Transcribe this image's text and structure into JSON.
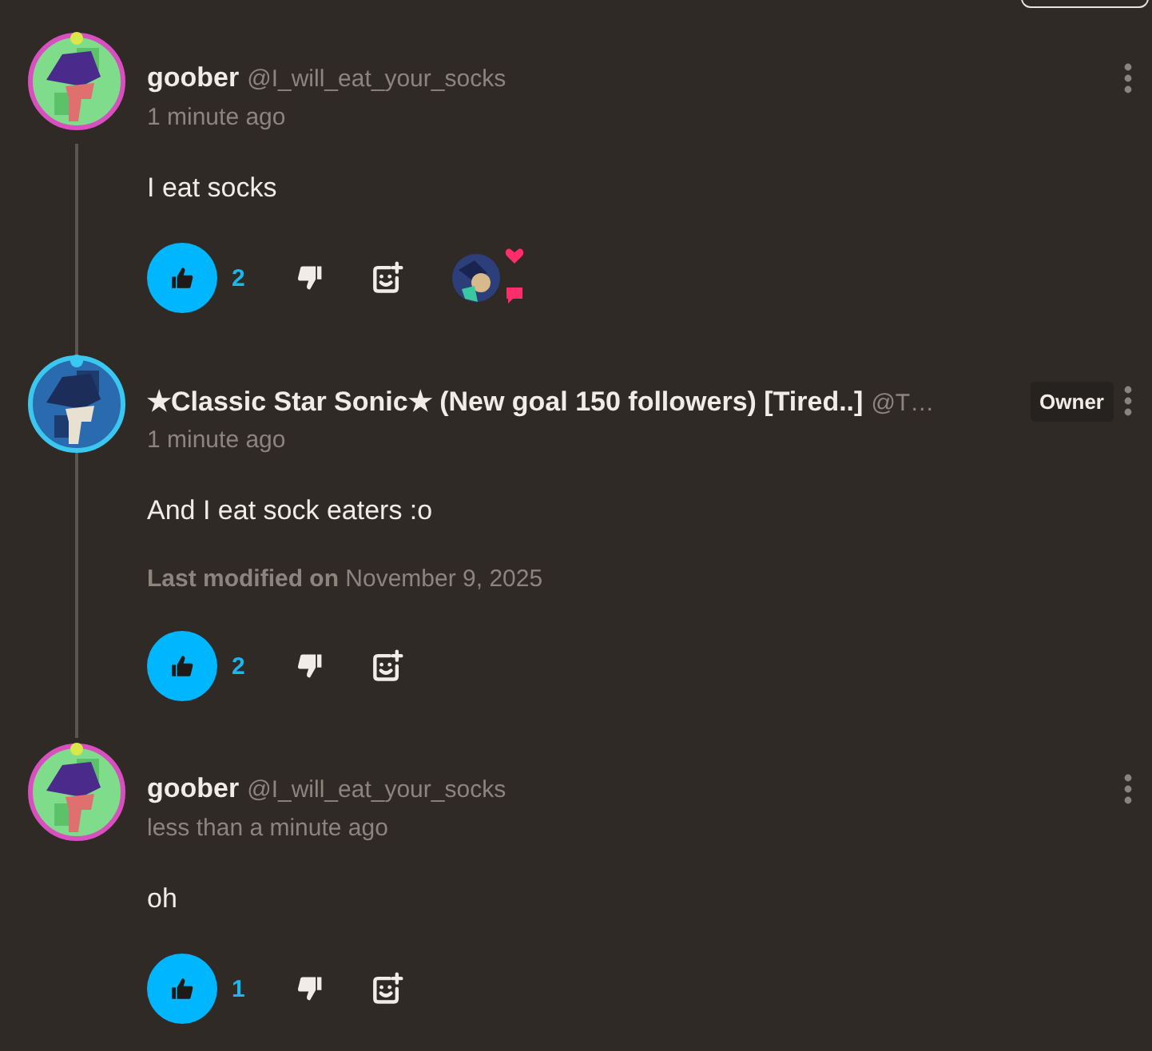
{
  "comments": [
    {
      "author": "goober",
      "handle": "@I_will_eat_your_socks",
      "time": "1 minute ago",
      "body": "I eat socks",
      "liked": true,
      "likes": "2",
      "reacted": true
    },
    {
      "author": "★Classic Star Sonic★ (New goal 150 followers) [Tired..]",
      "handle": "@T…",
      "badge": "Owner",
      "time": "1 minute ago",
      "body": "And I eat sock eaters :o",
      "modified_label": "Last modified on",
      "modified_date": "November 9, 2025",
      "liked": true,
      "likes": "2"
    },
    {
      "author": "goober",
      "handle": "@I_will_eat_your_socks",
      "time": "less than a minute ago",
      "body": "oh",
      "liked": true,
      "likes": "1"
    }
  ]
}
